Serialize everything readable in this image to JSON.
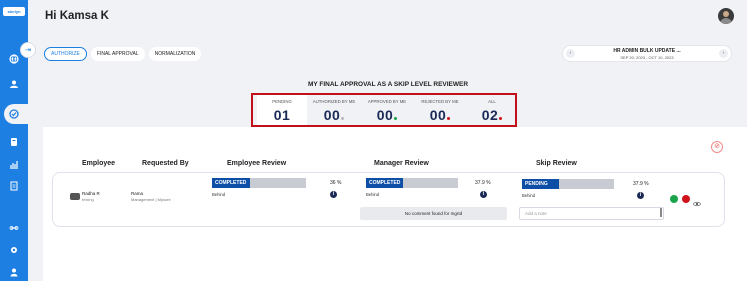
{
  "app": {
    "logo_text": "sterlyn"
  },
  "header": {
    "greeting": "Hi Kamsa K"
  },
  "tabs": [
    {
      "label": "AUTHORIZE",
      "active": true
    },
    {
      "label": "FINAL APPROVAL",
      "active": false
    },
    {
      "label": "NORMALIZATION",
      "active": false
    }
  ],
  "period": {
    "title": "HR ADMIN BULK UPDATE ...",
    "dates": "SEP 20, 2023 - OCT 10, 2023",
    "prev": "‹",
    "next": "›"
  },
  "summary": {
    "title": "MY FINAL APPROVAL AS A SKIP LEVEL REVIEWER",
    "stats": [
      {
        "label": "PENDING",
        "value": "01",
        "dot": null
      },
      {
        "label": "AUTHORIZED BY ME",
        "value": "00",
        "dot": "#b9b9b9"
      },
      {
        "label": "APPROVED BY ME",
        "value": "00",
        "dot": "#1aa34a"
      },
      {
        "label": "REJECTED BY ME",
        "value": "00",
        "dot": "#d0121b"
      },
      {
        "label": "ALL",
        "value": "02",
        "dot": "#d0121b"
      }
    ]
  },
  "table": {
    "headers": {
      "employee": "Employee",
      "requested_by": "Requested By",
      "employee_review": "Employee Review",
      "manager_review": "Manager Review",
      "skip_review": "Skip Review"
    },
    "row": {
      "employee_name": "Radha R",
      "employee_sub": "testing",
      "requester_name": "Rama",
      "requester_sub": "Management | Mysore",
      "employee_review": {
        "status": "COMPLETED",
        "percent": "36 %",
        "progress": 0.36,
        "tag": "Behind"
      },
      "manager_review": {
        "status": "COMPLETED",
        "percent": "37.9 %",
        "progress": 0.379,
        "tag": "Behind",
        "comment": "No comment found for mgrId"
      },
      "skip_review": {
        "status": "PENDING",
        "percent": "37.9 %",
        "progress": 0.379,
        "tag": "Behind",
        "note_placeholder": "Add a note"
      }
    }
  },
  "colors": {
    "sidebar": "#1e7fe2",
    "highlight_box": "#c0111b",
    "navy": "#1a2a55",
    "progress_fill": "#0d4ea6",
    "approve": "#1aa34a",
    "reject": "#d0121b"
  }
}
